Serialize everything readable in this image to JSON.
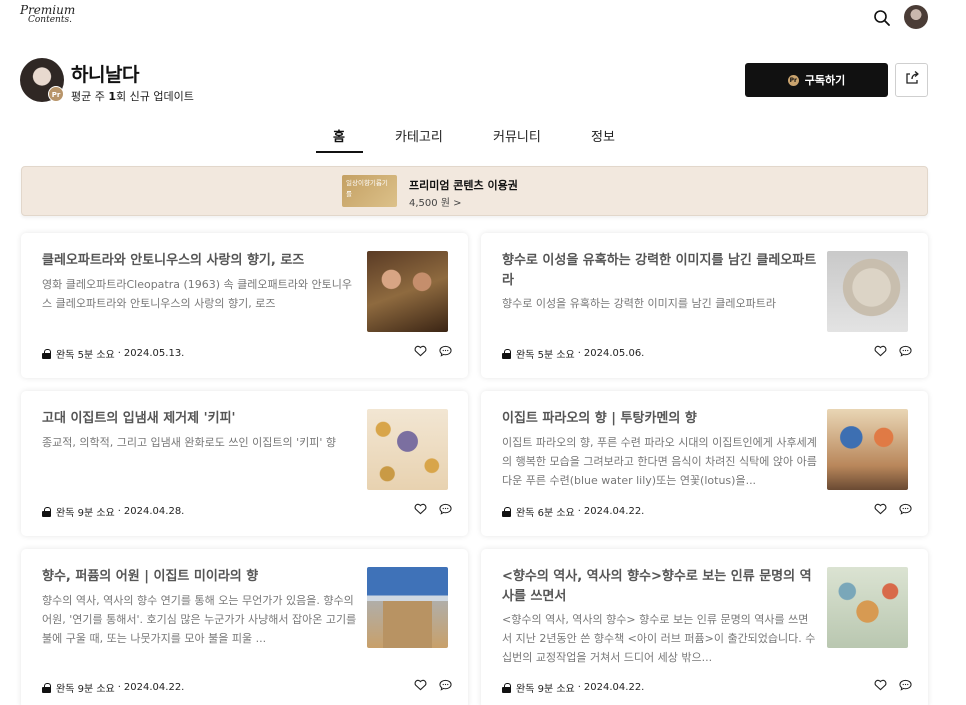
{
  "brand": {
    "logo_line1": "Premium",
    "logo_line2": "Contents."
  },
  "creator": {
    "name": "하니날다",
    "frequency_prefix": "평균 주 ",
    "frequency_count": "1",
    "frequency_suffix": "회 신규 업데이트",
    "badge": "Pr"
  },
  "actions": {
    "subscribe_label": "구독하기",
    "subscribe_badge": "Pr"
  },
  "tabs": [
    {
      "label": "홈",
      "active": true
    },
    {
      "label": "카테고리",
      "active": false
    },
    {
      "label": "커뮤니티",
      "active": false
    },
    {
      "label": "정보",
      "active": false
    }
  ],
  "banner": {
    "voucher_text": "일상이향기롭기를",
    "title": "프리미엄 콘텐츠 이용권",
    "price": "4,500 원 >"
  },
  "posts": [
    {
      "title": "클레오파트라와 안토니우스의 사랑의 향기, 로즈",
      "desc": "영화 클레오파트라Cleopatra (1963) 속 클레오패트라와 안토니우스 클레오파트라와 안토니우스의 사랑의 향기, 로즈",
      "read_time": "완독 5분 소요",
      "date": "2024.05.13."
    },
    {
      "title": "향수로 이성을 유혹하는 강력한 이미지를 남긴 클레오파트라",
      "desc": "향수로 이성을 유혹하는 강력한 이미지를 남긴 클레오파트라",
      "read_time": "완독 5분 소요",
      "date": "2024.05.06."
    },
    {
      "title": "고대 이집트의 입냄새 제거제 '키피'",
      "desc": "종교적, 의학적, 그리고 입냄새 완화로도 쓰인 이집트의 '키피' 향",
      "read_time": "완독 9분 소요",
      "date": "2024.04.28."
    },
    {
      "title": "이집트 파라오의 향 | 투탕카멘의 향",
      "desc": "이집트 파라오의 향, 푸른 수련 파라오 시대의 이집트인에게 사후세계의 행복한 모습을 그려보라고 한다면 음식이 차려진 식탁에 앉아 아름다운 푸른 수련(blue water lily)또는 연꽃(lotus)을...",
      "read_time": "완독 6분 소요",
      "date": "2024.04.22."
    },
    {
      "title": "향수, 퍼퓸의 어원 | 이집트 미이라의 향",
      "desc": "향수의 역사, 역사의 향수 연기를 통해 오는 무언가가 있음을. 향수의 어원, '연기를 통해서'. 호기심 많은 누군가가 사냥해서 잡아온 고기를 불에 구울 때, 또는 나뭇가지를 모아 불을 피울 ...",
      "read_time": "완독 9분 소요",
      "date": "2024.04.22."
    },
    {
      "title": "<향수의 역사, 역사의 향수>향수로 보는 인류 문명의 역사를 쓰면서",
      "desc": "<향수의 역사, 역사의 향수> 향수로 보는 인류 문명의 역사를 쓰면서 지난 2년동안 쓴 향수책 <아이 러브 퍼퓸>이 출간되었습니다. 수십번의 교정작업을 거쳐서 드디어 세상 밖으...",
      "read_time": "완독 9분 소요",
      "date": "2024.04.22."
    }
  ]
}
